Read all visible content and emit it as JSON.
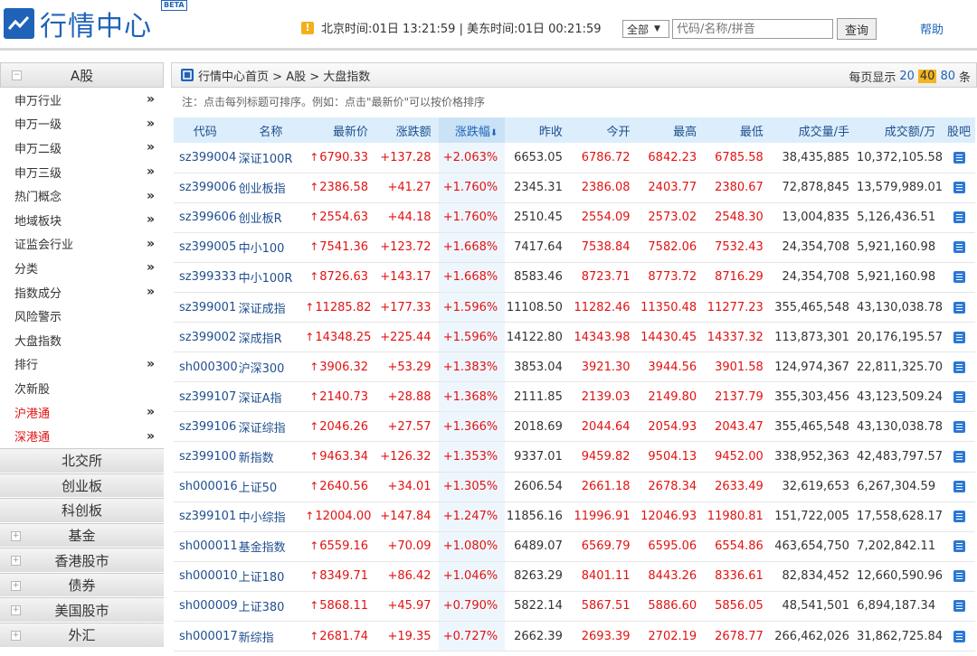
{
  "header": {
    "logo_text": "行情中心",
    "beta": "BETA",
    "clock_icon": "alert-icon",
    "clock_text": "北京时间:01日 13:21:59 | 美东时间:01日 00:21:59",
    "search_select": "全部",
    "search_placeholder": "代码/名称/拼音",
    "search_button": "查询",
    "help": "帮助"
  },
  "sidebar": {
    "title": "A股",
    "items": [
      {
        "label": "申万行业",
        "arrow": "»",
        "red": false
      },
      {
        "label": "申万一级",
        "arrow": "»",
        "red": false
      },
      {
        "label": "申万二级",
        "arrow": "»",
        "red": false
      },
      {
        "label": "申万三级",
        "arrow": "»",
        "red": false
      },
      {
        "label": "热门概念",
        "arrow": "»",
        "red": false
      },
      {
        "label": "地域板块",
        "arrow": "»",
        "red": false
      },
      {
        "label": "证监会行业",
        "arrow": "»",
        "red": false
      },
      {
        "label": "分类",
        "arrow": "»",
        "red": false
      },
      {
        "label": "指数成分",
        "arrow": "»",
        "red": false
      },
      {
        "label": "风险警示",
        "arrow": "",
        "red": false
      },
      {
        "label": "大盘指数",
        "arrow": "",
        "red": false
      },
      {
        "label": "排行",
        "arrow": "»",
        "red": false
      },
      {
        "label": "次新股",
        "arrow": "",
        "red": false
      },
      {
        "label": "沪港通",
        "arrow": "»",
        "red": true
      },
      {
        "label": "深港通",
        "arrow": "»",
        "red": true
      }
    ],
    "sections": [
      {
        "label": "北交所",
        "toggle": false
      },
      {
        "label": "创业板",
        "toggle": false
      },
      {
        "label": "科创板",
        "toggle": false
      },
      {
        "label": "基金",
        "toggle": true
      },
      {
        "label": "香港股市",
        "toggle": true
      },
      {
        "label": "债券",
        "toggle": true
      },
      {
        "label": "美国股市",
        "toggle": true
      },
      {
        "label": "外汇",
        "toggle": true
      }
    ]
  },
  "main": {
    "breadcrumb": [
      "行情中心首页",
      "A股",
      "大盘指数"
    ],
    "breadcrumb_sep": ">",
    "per_page_label": "每页显示",
    "per_page_options": [
      "20",
      "40",
      "80"
    ],
    "per_page_active": "40",
    "per_page_suffix": "条",
    "note": "注：点击每列标题可排序。例如：点击\"最新价\"可以按价格排序",
    "columns": [
      "代码",
      "名称",
      "最新价",
      "涨跌额",
      "涨跌幅",
      "昨收",
      "今开",
      "最高",
      "最低",
      "成交量/手",
      "成交额/万",
      "股吧"
    ],
    "sorted_column": "涨跌幅",
    "rows": [
      [
        "sz399004",
        "深证100R",
        "6790.33",
        "+137.28",
        "+2.063%",
        "6653.05",
        "6786.72",
        "6842.23",
        "6785.58",
        "38,435,885",
        "10,372,105.58"
      ],
      [
        "sz399006",
        "创业板指",
        "2386.58",
        "+41.27",
        "+1.760%",
        "2345.31",
        "2386.08",
        "2403.77",
        "2380.67",
        "72,878,845",
        "13,579,989.01"
      ],
      [
        "sz399606",
        "创业板R",
        "2554.63",
        "+44.18",
        "+1.760%",
        "2510.45",
        "2554.09",
        "2573.02",
        "2548.30",
        "13,004,835",
        "5,126,436.51"
      ],
      [
        "sz399005",
        "中小100",
        "7541.36",
        "+123.72",
        "+1.668%",
        "7417.64",
        "7538.84",
        "7582.06",
        "7532.43",
        "24,354,708",
        "5,921,160.98"
      ],
      [
        "sz399333",
        "中小100R",
        "8726.63",
        "+143.17",
        "+1.668%",
        "8583.46",
        "8723.71",
        "8773.72",
        "8716.29",
        "24,354,708",
        "5,921,160.98"
      ],
      [
        "sz399001",
        "深证成指",
        "11285.82",
        "+177.33",
        "+1.596%",
        "11108.50",
        "11282.46",
        "11350.48",
        "11277.23",
        "355,465,548",
        "43,130,038.78"
      ],
      [
        "sz399002",
        "深成指R",
        "14348.25",
        "+225.44",
        "+1.596%",
        "14122.80",
        "14343.98",
        "14430.45",
        "14337.32",
        "113,873,301",
        "20,176,195.57"
      ],
      [
        "sh000300",
        "沪深300",
        "3906.32",
        "+53.29",
        "+1.383%",
        "3853.04",
        "3921.30",
        "3944.56",
        "3901.58",
        "124,974,367",
        "22,811,325.70"
      ],
      [
        "sz399107",
        "深证A指",
        "2140.73",
        "+28.88",
        "+1.368%",
        "2111.85",
        "2139.03",
        "2149.80",
        "2137.79",
        "355,303,456",
        "43,123,509.24"
      ],
      [
        "sz399106",
        "深证综指",
        "2046.26",
        "+27.57",
        "+1.366%",
        "2018.69",
        "2044.64",
        "2054.93",
        "2043.47",
        "355,465,548",
        "43,130,038.78"
      ],
      [
        "sz399100",
        "新指数",
        "9463.34",
        "+126.32",
        "+1.353%",
        "9337.01",
        "9459.82",
        "9504.13",
        "9452.00",
        "338,952,363",
        "42,483,797.57"
      ],
      [
        "sh000016",
        "上证50",
        "2640.56",
        "+34.01",
        "+1.305%",
        "2606.54",
        "2661.18",
        "2678.34",
        "2633.49",
        "32,619,653",
        "6,267,304.59"
      ],
      [
        "sz399101",
        "中小综指",
        "12004.00",
        "+147.84",
        "+1.247%",
        "11856.16",
        "11996.91",
        "12046.93",
        "11980.81",
        "151,722,005",
        "17,558,628.17"
      ],
      [
        "sh000011",
        "基金指数",
        "6559.16",
        "+70.09",
        "+1.080%",
        "6489.07",
        "6569.79",
        "6595.06",
        "6554.86",
        "463,654,750",
        "7,202,842.11"
      ],
      [
        "sh000010",
        "上证180",
        "8349.71",
        "+86.42",
        "+1.046%",
        "8263.29",
        "8401.11",
        "8443.26",
        "8336.61",
        "82,834,452",
        "12,660,590.96"
      ],
      [
        "sh000009",
        "上证380",
        "5868.11",
        "+45.97",
        "+0.790%",
        "5822.14",
        "5867.51",
        "5886.60",
        "5856.05",
        "48,541,501",
        "6,894,187.34"
      ],
      [
        "sh000017",
        "新综指",
        "2681.74",
        "+19.35",
        "+0.727%",
        "2662.39",
        "2693.39",
        "2702.19",
        "2678.77",
        "266,462,026",
        "31,862,725.84"
      ]
    ],
    "up_glyph": "↑",
    "bar_icon": "forum-icon",
    "colors": {
      "up": "#e21212",
      "link": "#1f4f8f",
      "header_bg": "#dceefb",
      "accent": "#1f63b8"
    }
  }
}
